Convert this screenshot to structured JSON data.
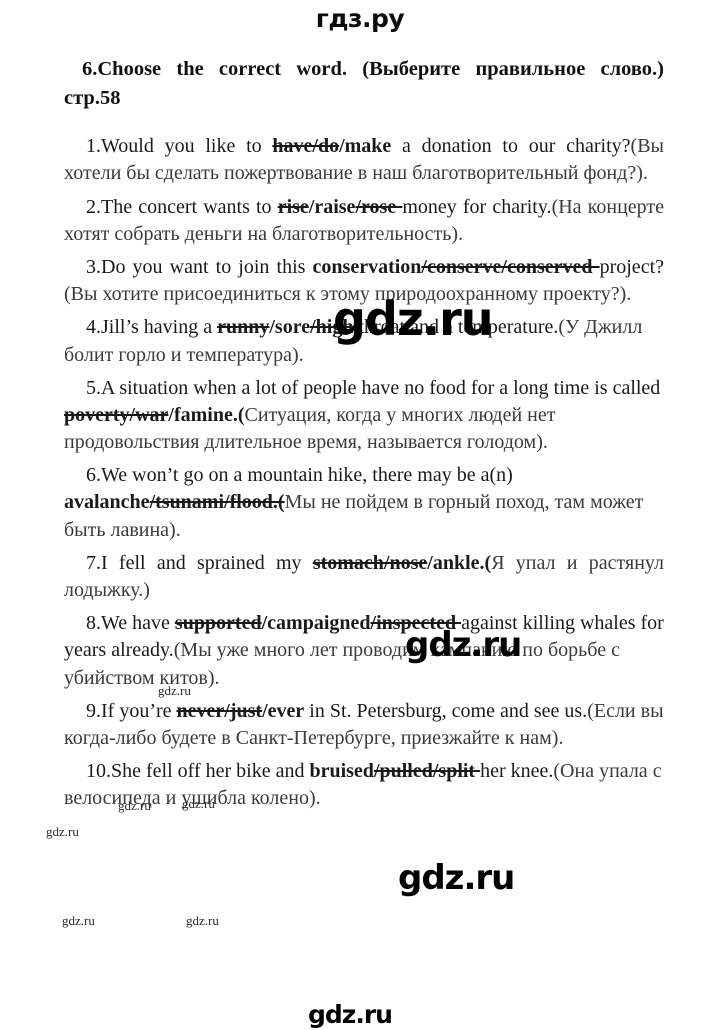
{
  "site": {
    "logo_top": "гдз.ру",
    "logo_bottom": "gdz.ru"
  },
  "task": {
    "title": "6.Choose the correct word. (Выберите правильное слово.) стр.58"
  },
  "questions": [
    {
      "number": "1.",
      "pre": "Would you like to ",
      "struck": "have/do",
      "correct": "/make",
      "post": " a donation to our charity?",
      "translation": "(Вы хотели бы сделать пожертвование в наш благотворительный фонд?)."
    },
    {
      "number": "2.",
      "pre": "The concert wants to ",
      "struck": "rise",
      "correct": "/raise",
      "struck2": "/rose ",
      "post": "money for charity.",
      "translation": "(На концерте хотят собрать деньги на благотворительность)."
    },
    {
      "number": "3.",
      "pre": "Do you want to join this ",
      "correct": "conservation",
      "struck": "/conserve/conserved ",
      "post": "project? ",
      "translation": "(Вы хотите присоединиться к этому природоохранному проекту?)."
    },
    {
      "number": "4.",
      "pre": "Jill’s having a ",
      "struck": "runny",
      "correct": "/sore",
      "struck2": "/high ",
      "post": "throat and a temperature.",
      "translation": "(У Джилл болит горло и температура)."
    },
    {
      "number": "5.",
      "pre": "A situation when a lot of people have no food for a long time is called ",
      "struck": "poverty/war",
      "correct": "/famine.(",
      "post": "",
      "translation": "Ситуация, когда у многих людей нет продовольствия длительное время, называется голодом)."
    },
    {
      "number": "6.",
      "pre": "We won’t go on a mountain hike, there may be a(n) ",
      "correct": "avalanche",
      "struck": "/tsunami/flood.(",
      "post": "",
      "translation": "Мы не пойдем в горный поход, там может быть лавина)."
    },
    {
      "number": "7.",
      "pre": "I fell and sprained my ",
      "struck": "stomach/nose",
      "correct": "/ankle.(",
      "post": "",
      "translation": "Я упал и растянул лодыжку.)"
    },
    {
      "number": "8.",
      "pre": "We have ",
      "struck": "supported",
      "correct": "/campaigned",
      "struck2": "/inspected ",
      "post": "against killing whales for years already.",
      "translation": "(Мы уже много лет проводим кампанию по борьбе с убийством китов)."
    },
    {
      "number": "9.",
      "pre": "If you’re ",
      "struck": "never/just",
      "correct": "/ever",
      "post": " in St. Petersburg, come and see us.",
      "translation": "(Если вы когда-либо будете в Санкт-Петербурге, приезжайте к нам)."
    },
    {
      "number": "10.",
      "pre": "She fell off her bike and ",
      "correct": "bruised",
      "struck": "/pulled/split ",
      "post": "her knee.",
      "translation": "(Она упала с велосипеда и ушибла колено)."
    }
  ],
  "watermarks": [
    {
      "text": "gdz.ru"
    },
    {
      "text": "gdz.ru"
    },
    {
      "text": "gdz.ru"
    },
    {
      "text": "gdz.ru"
    },
    {
      "text": "gdz.ru"
    },
    {
      "text": "gdz.ru"
    },
    {
      "text": "gdz.ru"
    },
    {
      "text": "gdz.ru"
    },
    {
      "text": "gdz.ru"
    },
    {
      "text": "gdz.ru"
    }
  ]
}
